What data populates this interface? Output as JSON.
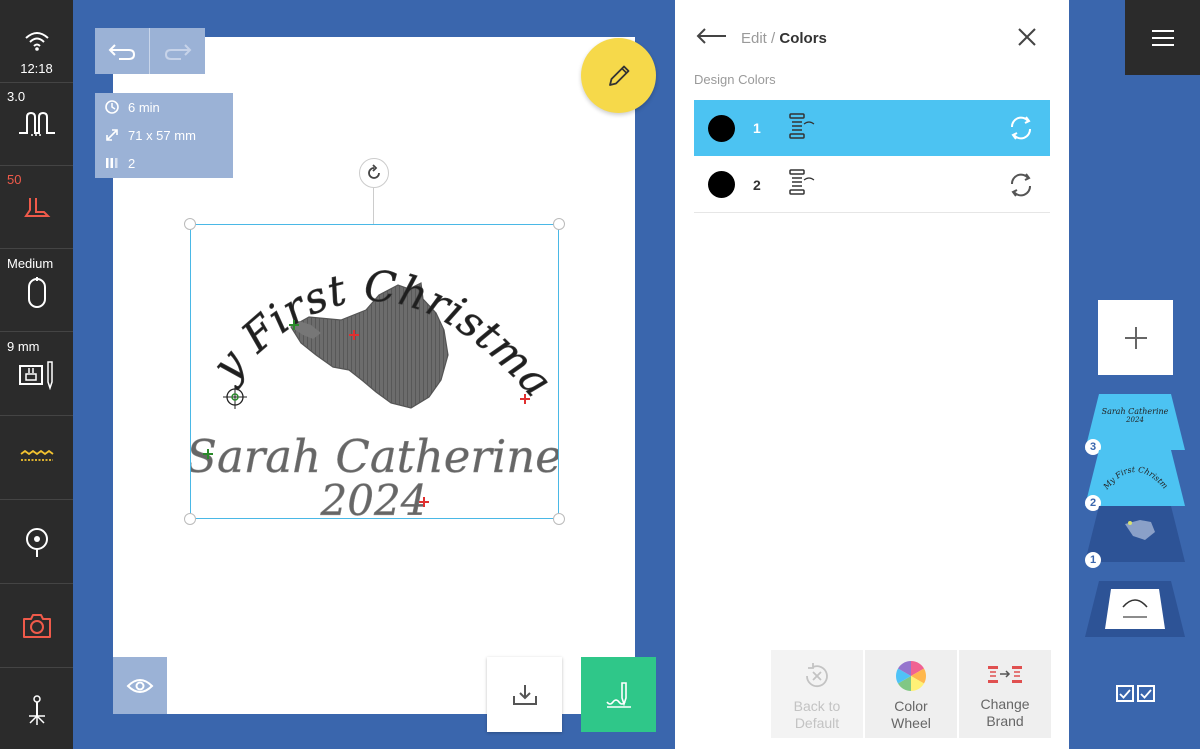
{
  "status": {
    "time": "12:18",
    "stitch_width": "3.0",
    "presser_foot": "50",
    "hoop": "Medium",
    "needle_size": "9 mm"
  },
  "canvas": {
    "info": {
      "time": "6 min",
      "size": "71 x 57 mm",
      "colors": "2"
    },
    "design": {
      "line1": "My First Christmas",
      "line2": "Sarah Catherine",
      "line3": "2024"
    }
  },
  "panel": {
    "breadcrumb_parent": "Edit",
    "breadcrumb_sep": " / ",
    "breadcrumb_current": "Colors",
    "section_title": "Design Colors",
    "colors": [
      {
        "number": "1",
        "swatch": "#000000"
      },
      {
        "number": "2",
        "swatch": "#000000"
      }
    ],
    "buttons": {
      "back_default_1": "Back to",
      "back_default_2": "Default",
      "color_wheel_1": "Color",
      "color_wheel_2": "Wheel",
      "change_brand_1": "Change",
      "change_brand_2": "Brand"
    }
  },
  "layers": [
    "3",
    "2",
    "1"
  ],
  "colors": {
    "accent_blue": "#3a66ad",
    "selected_row": "#4cc3f2",
    "edit_fab": "#f6d94a",
    "stitch_button": "#2fc789"
  }
}
